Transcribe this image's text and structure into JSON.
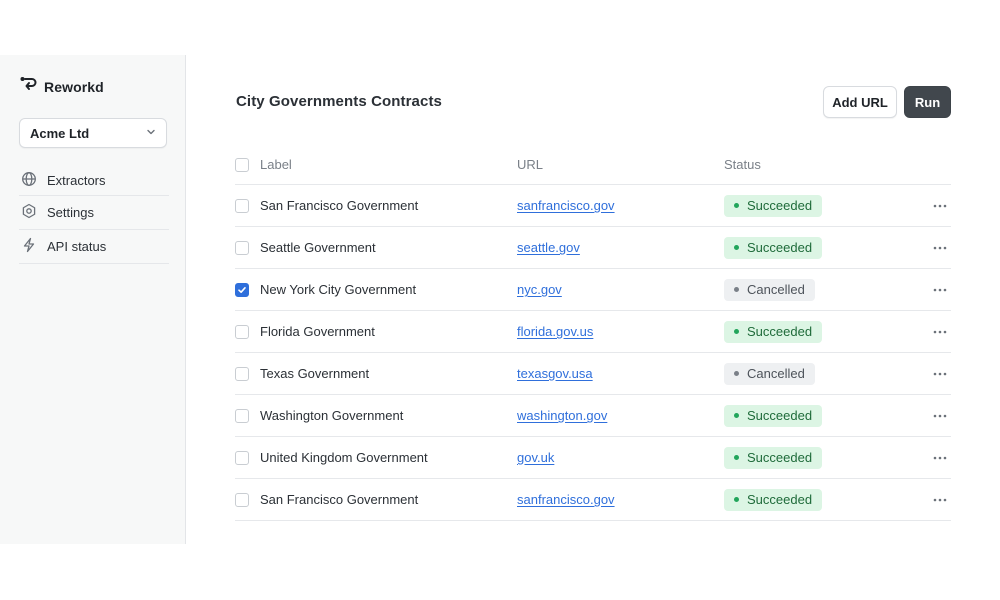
{
  "sidebar": {
    "brand": "Reworkd",
    "org_select": "Acme Ltd",
    "items": [
      {
        "label": "Extractors",
        "icon": "globe-icon"
      },
      {
        "label": "Settings",
        "icon": "gear-icon"
      },
      {
        "label": "API status",
        "icon": "lightning-icon"
      }
    ]
  },
  "main": {
    "title": "City Governments Contracts",
    "add_url_label": "Add URL",
    "run_label": "Run",
    "columns": {
      "label": "Label",
      "url": "URL",
      "status": "Status"
    },
    "rows": [
      {
        "label": "San Francisco Government",
        "url": "sanfrancisco.gov",
        "status": "Succeeded",
        "checked": false
      },
      {
        "label": "Seattle Government",
        "url": "seattle.gov",
        "status": "Succeeded",
        "checked": false
      },
      {
        "label": "New York City Government",
        "url": "nyc.gov",
        "status": "Cancelled",
        "checked": true
      },
      {
        "label": "Florida Government",
        "url": "florida.gov.us",
        "status": "Succeeded",
        "checked": false
      },
      {
        "label": "Texas Government",
        "url": "texasgov.usa",
        "status": "Cancelled",
        "checked": false
      },
      {
        "label": "Washington Government",
        "url": "washington.gov",
        "status": "Succeeded",
        "checked": false
      },
      {
        "label": "United Kingdom Government",
        "url": "gov.uk",
        "status": "Succeeded",
        "checked": false
      },
      {
        "label": "San Francisco Government",
        "url": "sanfrancisco.gov",
        "status": "Succeeded",
        "checked": false
      }
    ]
  },
  "colors": {
    "accent": "#2f6fdb",
    "run_button": "#41474d",
    "success_bg": "#dcf5e4",
    "success_dot": "#22a55b",
    "cancelled_bg": "#eef0f2"
  }
}
